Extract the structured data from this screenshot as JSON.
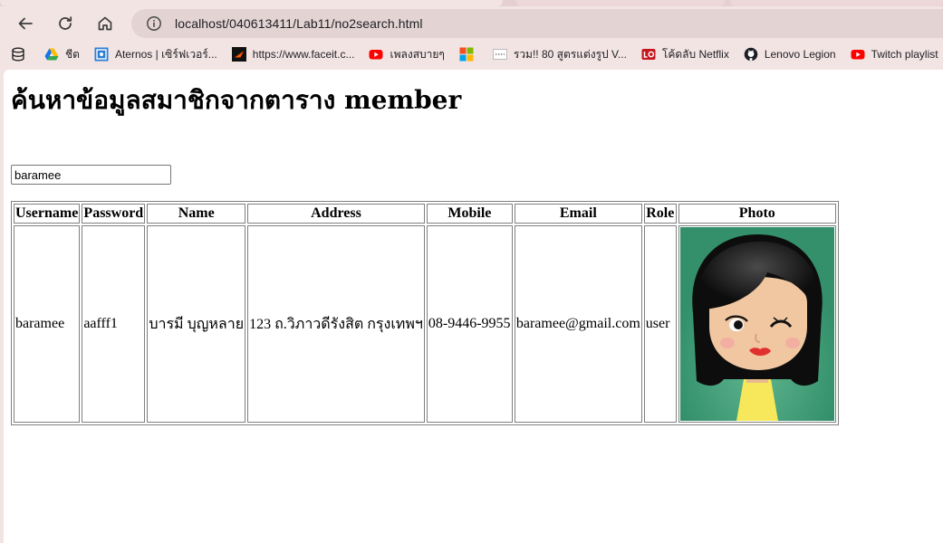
{
  "browser": {
    "url": "localhost/040613411/Lab11/no2search.html",
    "bookmarks": [
      {
        "label": "",
        "icon": "database-icon"
      },
      {
        "label": "ชีต",
        "icon": "google-drive-icon"
      },
      {
        "label": "Aternos | เซิร์ฟเวอร์...",
        "icon": "aternos-icon"
      },
      {
        "label": "https://www.faceit.c...",
        "icon": "faceit-icon"
      },
      {
        "label": "เพลงสบายๆ",
        "icon": "youtube-icon"
      },
      {
        "label": "",
        "icon": "microsoft-icon"
      },
      {
        "label": "รวม!! 80 สูตรแต่งรูป V...",
        "icon": "page-icon"
      },
      {
        "label": "โค้ดลับ Netflix",
        "icon": "lo-icon"
      },
      {
        "label": "Lenovo Legion",
        "icon": "github-icon"
      },
      {
        "label": "Twitch playlist",
        "icon": "youtube-icon"
      },
      {
        "label": "",
        "icon": "vivaldi-icon"
      }
    ]
  },
  "page": {
    "title": "ค้นหาข้อมูลสมาชิกจากตาราง member",
    "search": {
      "value": "baramee"
    },
    "table": {
      "headers": [
        "Username",
        "Password",
        "Name",
        "Address",
        "Mobile",
        "Email",
        "Role",
        "Photo"
      ],
      "row": {
        "username": "baramee",
        "password": "aafff1",
        "name": "บารมี บุญหลาย",
        "address": "123 ถ.วิภาวดีรังสิต กรุงเทพฯ",
        "mobile": "08-9446-9955",
        "email": "baramee@gmail.com",
        "role": "user",
        "photo": "cartoon-girl-avatar"
      }
    }
  },
  "colors": {
    "chrome_bg": "#f3e4e4",
    "omnibox_bg": "#e3d3d3",
    "photo_bg": "#33906a",
    "hair": "#0d0d0d",
    "skin": "#f0c7a0",
    "shirt": "#f6e85a"
  }
}
